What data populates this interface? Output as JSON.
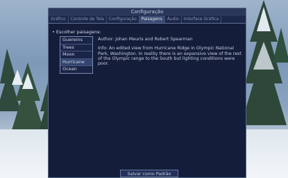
{
  "window": {
    "title": "Configuração"
  },
  "tabs": [
    {
      "label": "Gráfico"
    },
    {
      "label": "Controle de Tela"
    },
    {
      "label": "Configuração"
    },
    {
      "label": "Paisagens",
      "active": true
    },
    {
      "label": "Áudio"
    },
    {
      "label": "Interface Gráfica"
    }
  ],
  "section": {
    "label": "• Escolher paisagens:"
  },
  "landscapes": {
    "items": [
      {
        "label": "Guereins"
      },
      {
        "label": "Trees"
      },
      {
        "label": "Moon"
      },
      {
        "label": "Hurricane",
        "selected": true
      },
      {
        "label": "Ocean"
      }
    ]
  },
  "info": {
    "author": "Author: Johan Meuris and Robert Spearman",
    "description": "Info: An edited view from Hurricane Ridge in Olympic National Park, Washington.  In reality there is an expansive view of the rest of the Olympic range to the South but lighting conditions were poor."
  },
  "buttons": {
    "save_default": "Salvar como Padrão"
  }
}
